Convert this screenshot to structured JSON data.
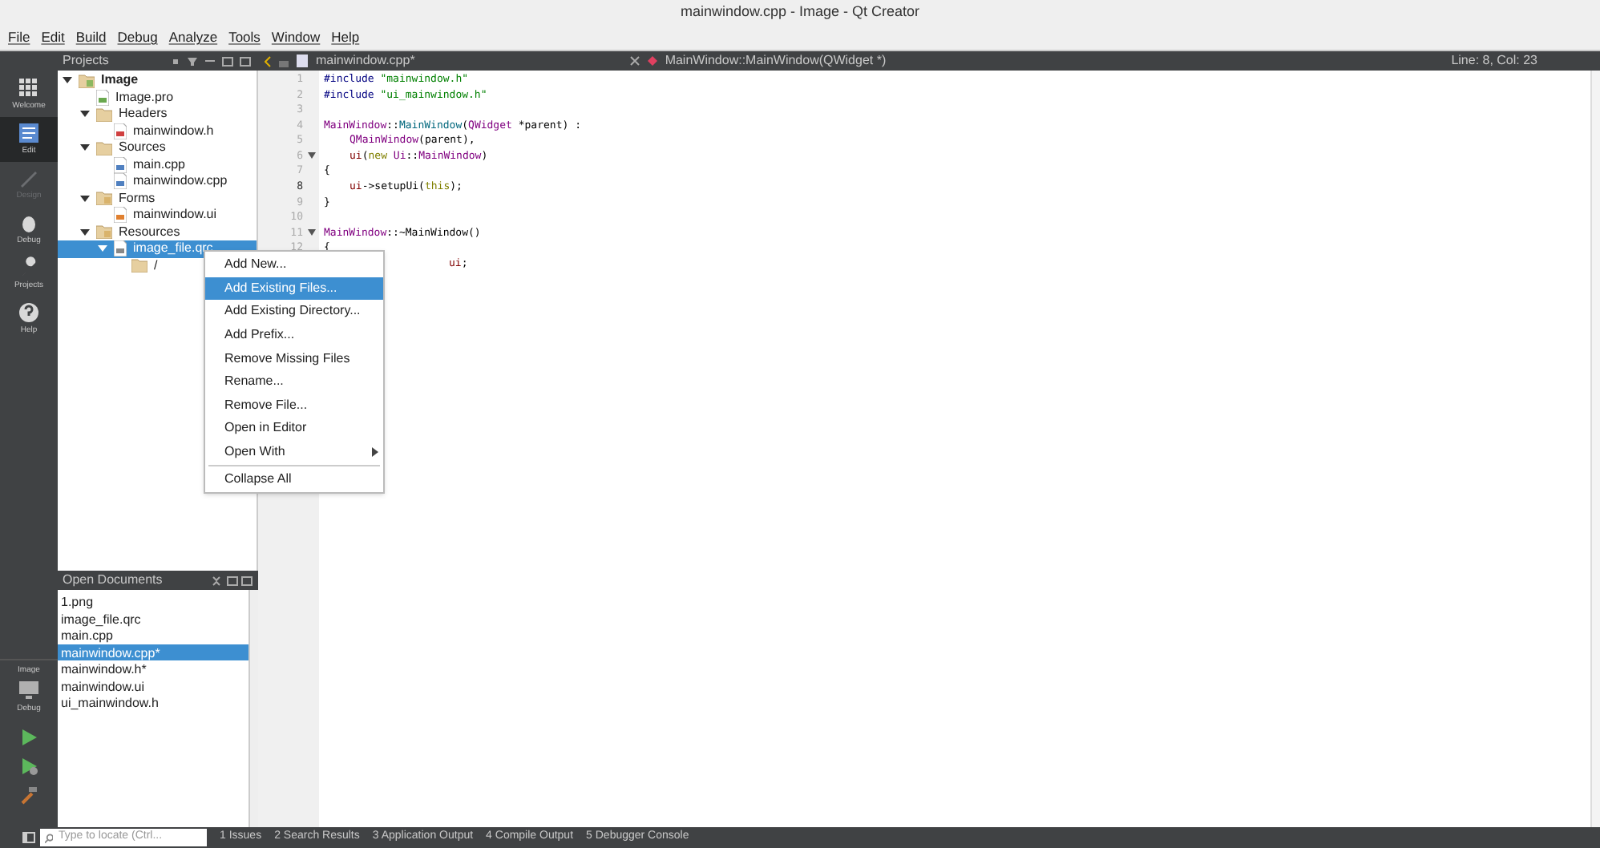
{
  "window": {
    "title": "mainwindow.cpp - Image - Qt Creator"
  },
  "menu": [
    "File",
    "Edit",
    "Build",
    "Debug",
    "Analyze",
    "Tools",
    "Window",
    "Help"
  ],
  "modes": [
    {
      "label": "Welcome",
      "selected": false,
      "disabled": false,
      "kind": "grid"
    },
    {
      "label": "Edit",
      "selected": true,
      "disabled": false,
      "kind": "edit"
    },
    {
      "label": "Design",
      "selected": false,
      "disabled": true,
      "kind": "design"
    },
    {
      "label": "Debug",
      "selected": false,
      "disabled": false,
      "kind": "debug"
    },
    {
      "label": "Projects",
      "selected": false,
      "disabled": false,
      "kind": "projects"
    },
    {
      "label": "Help",
      "selected": false,
      "disabled": false,
      "kind": "help"
    }
  ],
  "kit": {
    "project": "Image",
    "config": "Debug"
  },
  "projects_panel": {
    "title": "Projects",
    "tree": [
      {
        "label": "Image",
        "kind": "project",
        "expanded": true,
        "selected": false,
        "children": [
          {
            "label": "Image.pro",
            "kind": "pro",
            "selected": false
          },
          {
            "label": "Headers",
            "kind": "folder",
            "expanded": true,
            "selected": false,
            "children": [
              {
                "label": "mainwindow.h",
                "kind": "header",
                "selected": false
              }
            ]
          },
          {
            "label": "Sources",
            "kind": "folder",
            "expanded": true,
            "selected": false,
            "children": [
              {
                "label": "main.cpp",
                "kind": "source",
                "selected": false
              },
              {
                "label": "mainwindow.cpp",
                "kind": "source",
                "selected": false
              }
            ]
          },
          {
            "label": "Forms",
            "kind": "forms",
            "expanded": true,
            "selected": false,
            "children": [
              {
                "label": "mainwindow.ui",
                "kind": "ui",
                "selected": false
              }
            ]
          },
          {
            "label": "Resources",
            "kind": "resources",
            "expanded": true,
            "selected": false,
            "children": [
              {
                "label": "image_file.qrc",
                "kind": "qrc",
                "expanded": true,
                "selected": true,
                "children": [
                  {
                    "label": "/",
                    "kind": "folder",
                    "selected": false
                  }
                ]
              }
            ]
          }
        ]
      }
    ]
  },
  "open_documents": {
    "title": "Open Documents",
    "items": [
      {
        "label": "1.png",
        "selected": false
      },
      {
        "label": "image_file.qrc",
        "selected": false
      },
      {
        "label": "main.cpp",
        "selected": false
      },
      {
        "label": "mainwindow.cpp*",
        "selected": true
      },
      {
        "label": "mainwindow.h*",
        "selected": false
      },
      {
        "label": "mainwindow.ui",
        "selected": false
      },
      {
        "label": "ui_mainwindow.h",
        "selected": false
      }
    ]
  },
  "editor": {
    "tab": "mainwindow.cpp*",
    "symbol": "MainWindow::MainWindow(QWidget *)",
    "position": "Line: 8, Col: 23",
    "lines": [
      {
        "number": "1",
        "current": false,
        "fold": false,
        "kind": "flush",
        "segments": [
          {
            "kind": "directive",
            "text": "#include "
          },
          {
            "kind": "string",
            "text": "\"mainwindow.h\""
          }
        ]
      },
      {
        "number": "2",
        "current": false,
        "fold": false,
        "kind": "flush",
        "segments": [
          {
            "kind": "directive",
            "text": "#include "
          },
          {
            "kind": "string",
            "text": "\"ui_mainwindow.h\""
          }
        ]
      },
      {
        "number": "3",
        "current": false,
        "fold": false,
        "kind": "flush"
      },
      {
        "number": "4",
        "current": false,
        "fold": false,
        "kind": "flush",
        "segments": [
          {
            "kind": "type",
            "text": "MainWindow"
          },
          {
            "kind": "plain",
            "text": "::"
          },
          {
            "kind": "func",
            "text": "MainWindow"
          },
          {
            "kind": "plain",
            "text": "("
          },
          {
            "kind": "type",
            "text": "QWidget"
          },
          {
            "kind": "plain",
            "text": " *parent) :"
          }
        ]
      },
      {
        "number": "5",
        "current": false,
        "fold": false,
        "kind": "indented",
        "segments": [
          {
            "kind": "type",
            "text": "QMainWindow"
          },
          {
            "kind": "plain",
            "text": "(parent),"
          }
        ]
      },
      {
        "number": "6",
        "current": false,
        "fold": true,
        "kind": "indented",
        "segments": [
          {
            "kind": "member",
            "text": "ui"
          },
          {
            "kind": "plain",
            "text": "("
          },
          {
            "kind": "keyword",
            "text": "new"
          },
          {
            "kind": "type",
            "text": " Ui"
          },
          {
            "kind": "plain",
            "text": "::"
          },
          {
            "kind": "type",
            "text": "MainWindow"
          },
          {
            "kind": "plain",
            "text": ")"
          }
        ]
      },
      {
        "number": "7",
        "current": false,
        "fold": false,
        "kind": "flush",
        "segments": [
          {
            "kind": "plain",
            "text": "{"
          }
        ]
      },
      {
        "number": "8",
        "current": true,
        "fold": false,
        "kind": "indented",
        "segments": [
          {
            "kind": "member",
            "text": "ui"
          },
          {
            "kind": "plain",
            "text": "->setupUi("
          },
          {
            "kind": "keyword",
            "text": "this"
          },
          {
            "kind": "plain",
            "text": ");"
          }
        ]
      },
      {
        "number": "9",
        "current": false,
        "fold": false,
        "kind": "flush",
        "segments": [
          {
            "kind": "plain",
            "text": "}"
          }
        ]
      },
      {
        "number": "10",
        "current": false,
        "fold": false,
        "kind": "flush"
      },
      {
        "number": "11",
        "current": false,
        "fold": true,
        "kind": "flush",
        "segments": [
          {
            "kind": "type",
            "text": "MainWindow"
          },
          {
            "kind": "plain",
            "text": "::~MainWindow()"
          }
        ]
      },
      {
        "number": "12",
        "current": false,
        "fold": false,
        "kind": "flush",
        "segments": [
          {
            "kind": "plain",
            "text": "{"
          }
        ]
      },
      {
        "kind": "covered",
        "segments": [
          {
            "kind": "member",
            "text": "ui"
          },
          {
            "kind": "plain",
            "text": ";"
          }
        ]
      }
    ]
  },
  "context_menu": {
    "items": [
      {
        "label": "Add New...",
        "kind": "item",
        "selected": false
      },
      {
        "label": "Add Existing Files...",
        "kind": "item",
        "selected": true
      },
      {
        "label": "Add Existing Directory...",
        "kind": "item",
        "selected": false
      },
      {
        "label": "Add Prefix...",
        "kind": "item",
        "selected": false
      },
      {
        "label": "Remove Missing Files",
        "kind": "item",
        "selected": false
      },
      {
        "label": "Rename...",
        "kind": "item",
        "selected": false
      },
      {
        "label": "Remove File...",
        "kind": "item",
        "selected": false
      },
      {
        "label": "Open in Editor",
        "kind": "item",
        "selected": false
      },
      {
        "label": "Open With",
        "kind": "submenu",
        "selected": false
      },
      {
        "label": "Collapse All",
        "kind": "separated",
        "selected": false
      }
    ]
  },
  "status_bar": {
    "locator": {
      "placeholder": "Type to locate (Ctrl..."
    },
    "panes": [
      "1 Issues",
      "2 Search Results",
      "3 Application Output",
      "4 Compile Output",
      "5 Debugger Console"
    ]
  }
}
